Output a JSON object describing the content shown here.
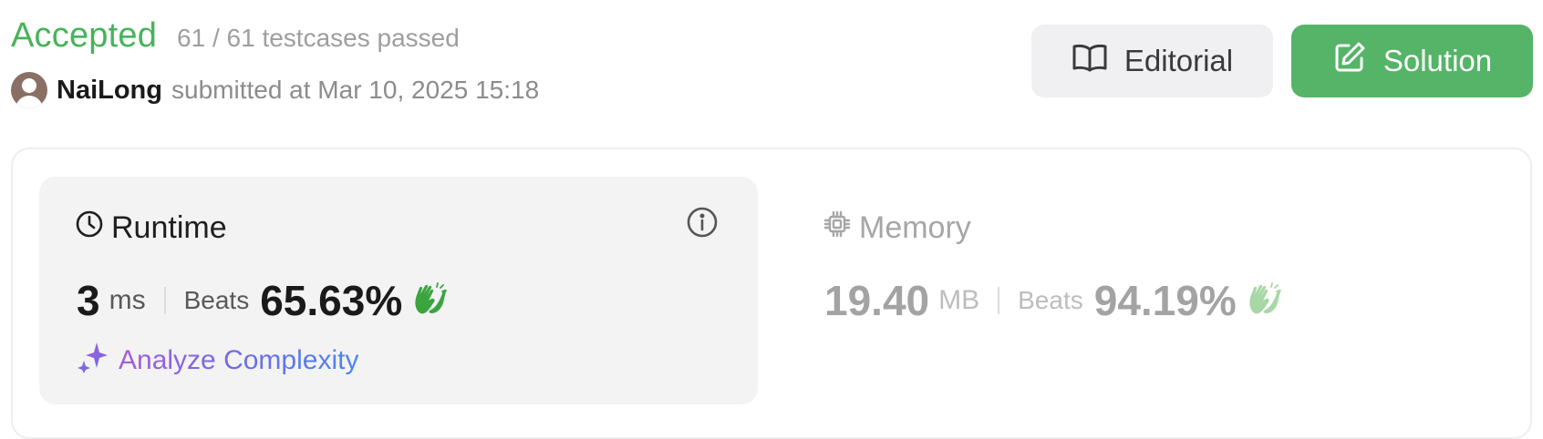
{
  "submission": {
    "status": "Accepted",
    "testcases": "61 / 61 testcases passed",
    "user": "NaiLong",
    "submitted_text": "submitted at Mar 10, 2025 15:18"
  },
  "actions": {
    "editorial_label": "Editorial",
    "solution_label": "Solution"
  },
  "runtime": {
    "title": "Runtime",
    "value": "3",
    "unit": "ms",
    "beats_label": "Beats",
    "beats_pct": "65.63%"
  },
  "memory": {
    "title": "Memory",
    "value": "19.40",
    "unit": "MB",
    "beats_label": "Beats",
    "beats_pct": "94.19%"
  },
  "analyze": {
    "label": "Analyze Complexity"
  },
  "colors": {
    "accepted": "#46b35a",
    "solution_button": "#55b467",
    "clap_active": "#3aa53f",
    "clap_inactive": "#a7d7a5"
  }
}
